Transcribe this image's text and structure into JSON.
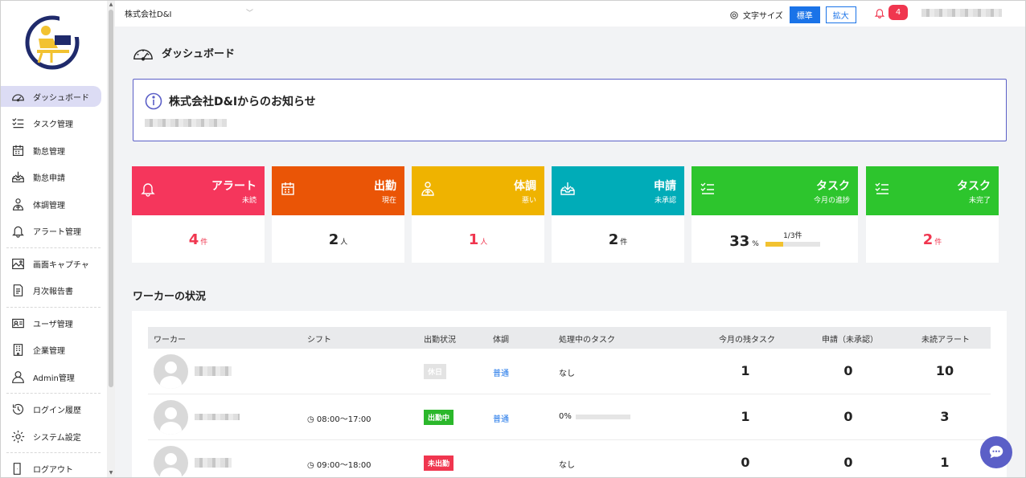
{
  "topbar": {
    "company": "株式会社D&I",
    "font_size_label": "文字サイズ",
    "standard_label": "標準",
    "large_label": "拡大",
    "notification_count": "4"
  },
  "sidebar": {
    "items": [
      {
        "label": "ダッシュボード",
        "icon": "dashboard-icon"
      },
      {
        "label": "タスク管理",
        "icon": "task-list-icon"
      },
      {
        "label": "勤怠管理",
        "icon": "calendar-icon"
      },
      {
        "label": "勤怠申請",
        "icon": "inbox-download-icon"
      },
      {
        "label": "体調管理",
        "icon": "health-person-icon"
      },
      {
        "label": "アラート管理",
        "icon": "bell-icon"
      },
      {
        "label": "画面キャプチャ",
        "icon": "image-icon"
      },
      {
        "label": "月次報告書",
        "icon": "document-icon"
      },
      {
        "label": "ユーザ管理",
        "icon": "id-card-icon"
      },
      {
        "label": "企業管理",
        "icon": "building-icon"
      },
      {
        "label": "Admin管理",
        "icon": "person-icon"
      },
      {
        "label": "ログイン履歴",
        "icon": "history-icon"
      },
      {
        "label": "システム設定",
        "icon": "gear-icon"
      },
      {
        "label": "ログアウト",
        "icon": "logout-icon"
      }
    ]
  },
  "page": {
    "title": "ダッシュボード",
    "notice_title": "株式会社D&Iからのお知らせ"
  },
  "cards": [
    {
      "title": "アラート",
      "sub": "未読",
      "value": "4",
      "unit": "件",
      "color": "#f5365c",
      "pink": true
    },
    {
      "title": "出勤",
      "sub": "現在",
      "value": "2",
      "unit": "人",
      "color": "#ea5506",
      "pink": false
    },
    {
      "title": "体調",
      "sub": "悪い",
      "value": "1",
      "unit": "人",
      "color": "#efb300",
      "pink": true
    },
    {
      "title": "申請",
      "sub": "未承認",
      "value": "2",
      "unit": "件",
      "color": "#00acb8",
      "pink": false
    },
    {
      "title": "タスク",
      "sub": "今月の進捗",
      "value": "33",
      "unit": "%",
      "progress_label": "1/3件",
      "progress": 0.33,
      "color": "#2dc52d",
      "pink": false
    },
    {
      "title": "タスク",
      "sub": "未完了",
      "value": "2",
      "unit": "件",
      "color": "#2dc52d",
      "pink": true
    }
  ],
  "workers": {
    "title": "ワーカーの状況",
    "headers": [
      "ワーカー",
      "シフト",
      "出勤状況",
      "体調",
      "処理中のタスク",
      "今月の残タスク",
      "申請（未承認）",
      "未読アラート"
    ],
    "rows": [
      {
        "shift": "",
        "status": "休日",
        "status_type": "off",
        "health": "普通",
        "task": "なし",
        "remaining": "1",
        "requests": "0",
        "alerts": "10"
      },
      {
        "shift": "◷ 08:00〜17:00",
        "status": "出勤中",
        "status_type": "on",
        "health": "普通",
        "task": "0%",
        "task_progress": 0,
        "remaining": "1",
        "requests": "0",
        "alerts": "3"
      },
      {
        "shift": "◷ 09:00〜18:00",
        "status": "未出勤",
        "status_type": "no",
        "health": "",
        "task": "なし",
        "remaining": "0",
        "requests": "0",
        "alerts": "1"
      }
    ]
  }
}
